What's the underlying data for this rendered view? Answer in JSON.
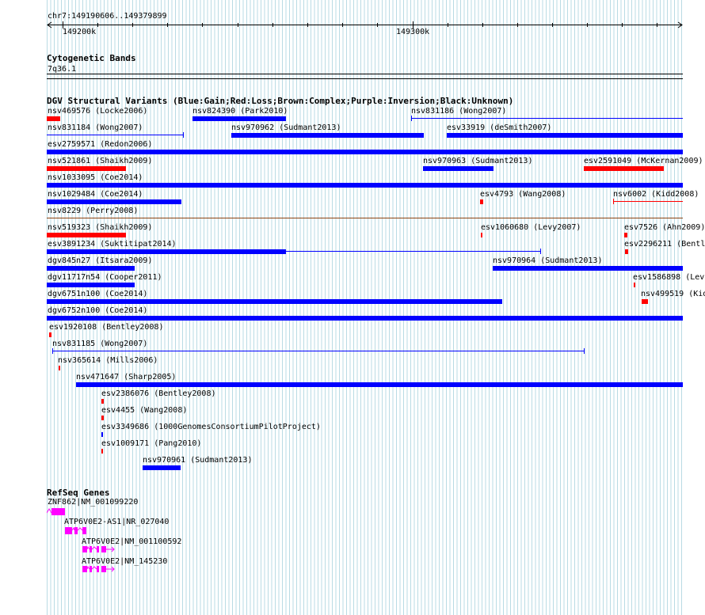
{
  "header": {
    "position": "chr7:149190606..149379899",
    "ruler_ticks": [
      "149200k",
      "149300k"
    ]
  },
  "tracks": {
    "cytoband": {
      "title": "Cytogenetic Bands",
      "band": "7q36.1"
    },
    "dgv": {
      "title": "DGV Structural Variants (Blue:Gain;Red:Loss;Brown:Complex;Purple:Inversion;Black:Unknown)",
      "colors": {
        "gain": "#0000ff",
        "loss": "#ff0000",
        "complex": "#8b4513",
        "inversion": "#800080",
        "unknown": "#000000"
      },
      "variants": [
        {
          "label": "nsv469576 (Locke2006)",
          "type": "loss"
        },
        {
          "label": "nsv824390 (Park2010)",
          "type": "gain"
        },
        {
          "label": "nsv831186 (Wong2007)",
          "type": "gain"
        },
        {
          "label": "nsv831184 (Wong2007)",
          "type": "gain"
        },
        {
          "label": "nsv970962 (Sudmant2013)",
          "type": "gain"
        },
        {
          "label": "esv33919 (deSmith2007)",
          "type": "gain"
        },
        {
          "label": "esv2759571 (Redon2006)",
          "type": "gain"
        },
        {
          "label": "nsv521861 (Shaikh2009)",
          "type": "loss"
        },
        {
          "label": "nsv970963 (Sudmant2013)",
          "type": "gain"
        },
        {
          "label": "esv2591049 (McKernan2009)",
          "type": "loss"
        },
        {
          "label": "nsv1033095 (Coe2014)",
          "type": "gain"
        },
        {
          "label": "nsv1029484 (Coe2014)",
          "type": "gain"
        },
        {
          "label": "esv4793 (Wang2008)",
          "type": "loss"
        },
        {
          "label": "nsv6002 (Kidd2008)",
          "type": "loss"
        },
        {
          "label": "nsv8229 (Perry2008)",
          "type": "complex"
        },
        {
          "label": "nsv519323 (Shaikh2009)",
          "type": "loss"
        },
        {
          "label": "esv1060680 (Levy2007)",
          "type": "loss"
        },
        {
          "label": "esv7526 (Ahn2009)",
          "type": "loss"
        },
        {
          "label": "esv3891234 (Suktitipat2014)",
          "type": "gain"
        },
        {
          "label": "esv2296211 (Bentl",
          "type": "loss"
        },
        {
          "label": "dgv845n27 (Itsara2009)",
          "type": "gain"
        },
        {
          "label": "nsv970964 (Sudmant2013)",
          "type": "gain"
        },
        {
          "label": "dgv11717n54 (Cooper2011)",
          "type": "gain"
        },
        {
          "label": "esv1586898 (Lev",
          "type": "loss"
        },
        {
          "label": "dgv6751n100 (Coe2014)",
          "type": "gain"
        },
        {
          "label": "nsv499519 (Kid",
          "type": "loss"
        },
        {
          "label": "dgv6752n100 (Coe2014)",
          "type": "gain"
        },
        {
          "label": "esv1920108 (Bentley2008)",
          "type": "loss"
        },
        {
          "label": "nsv831185 (Wong2007)",
          "type": "gain"
        },
        {
          "label": "nsv365614 (Mills2006)",
          "type": "loss"
        },
        {
          "label": "nsv471647 (Sharp2005)",
          "type": "gain"
        },
        {
          "label": "esv2386076 (Bentley2008)",
          "type": "loss"
        },
        {
          "label": "esv4455 (Wang2008)",
          "type": "loss"
        },
        {
          "label": "esv3349686 (1000GenomesConsortiumPilotProject)",
          "type": "gain"
        },
        {
          "label": "esv1009171 (Pang2010)",
          "type": "loss"
        },
        {
          "label": "nsv970961 (Sudmant2013)",
          "type": "gain"
        }
      ]
    },
    "refseq": {
      "title": "RefSeq Genes",
      "color": "#ff00ff",
      "genes": [
        {
          "label": "ZNF862|NM_001099220"
        },
        {
          "label": "ATP6V0E2-AS1|NR_027040"
        },
        {
          "label": "ATP6V0E2|NM_001100592"
        },
        {
          "label": "ATP6V0E2|NM_145230"
        }
      ]
    }
  }
}
